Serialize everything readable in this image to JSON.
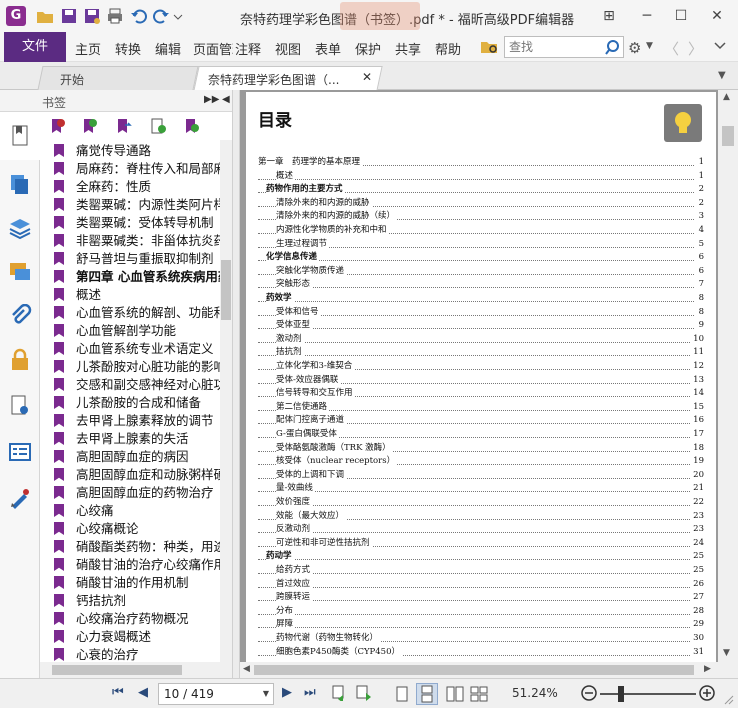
{
  "window": {
    "title": "奈特药理学彩色图谱（书签）.pdf * - 福昕高级PDF编辑器"
  },
  "menu": {
    "file": "文件",
    "items": [
      "主页",
      "转换",
      "编辑",
      "页面管理",
      "注释",
      "视图",
      "表单",
      "保护",
      "共享",
      "帮助"
    ],
    "search_placeholder": "查找"
  },
  "tabs": [
    {
      "label": "开始"
    },
    {
      "label": "奈特药理学彩色图谱（..."
    }
  ],
  "bookmarks": {
    "header": "书签",
    "items": [
      {
        "label": "痛觉传导通路",
        "bold": false
      },
      {
        "label": "局麻药：脊柱传入和局部麻醉",
        "bold": false
      },
      {
        "label": "全麻药：性质",
        "bold": false
      },
      {
        "label": "类罂粟碱：内源性类阿片样物质",
        "bold": false
      },
      {
        "label": "类罂粟碱：受体转导机制",
        "bold": false
      },
      {
        "label": "非罂粟碱类：非甾体抗炎药",
        "bold": false
      },
      {
        "label": "舒马普坦与重振取抑制剂",
        "bold": false
      },
      {
        "label": "第四章 心血管系统疾病用药",
        "bold": true
      },
      {
        "label": "概述",
        "bold": false
      },
      {
        "label": "心血管系统的解剖、功能和调节",
        "bold": false
      },
      {
        "label": "心血管解剖学功能",
        "bold": false
      },
      {
        "label": "心血管系统专业术语定义",
        "bold": false
      },
      {
        "label": "儿茶酚胺对心脏功能的影响",
        "bold": false
      },
      {
        "label": "交感和副交感神经对心脏功能",
        "bold": false
      },
      {
        "label": "儿茶酚胺的合成和储备",
        "bold": false
      },
      {
        "label": "去甲肾上腺素释放的调节",
        "bold": false
      },
      {
        "label": "去甲肾上腺素的失活",
        "bold": false
      },
      {
        "label": "高胆固醇血症的病因",
        "bold": false
      },
      {
        "label": "高胆固醇血症和动脉粥样硬化",
        "bold": false
      },
      {
        "label": "高胆固醇血症的药物治疗",
        "bold": false
      },
      {
        "label": "心绞痛",
        "bold": false
      },
      {
        "label": "心绞痛概论",
        "bold": false
      },
      {
        "label": "硝酸酯类药物：种类，用途",
        "bold": false
      },
      {
        "label": "硝酸甘油的治疗心绞痛作用",
        "bold": false
      },
      {
        "label": "硝酸甘油的作用机制",
        "bold": false
      },
      {
        "label": "钙拮抗剂",
        "bold": false
      },
      {
        "label": "心绞痛治疗药物概况",
        "bold": false
      },
      {
        "label": "心力衰竭概述",
        "bold": false
      },
      {
        "label": "心衰的治疗",
        "bold": false
      }
    ]
  },
  "document": {
    "heading": "目录",
    "toc": [
      {
        "level": 0,
        "text": "第一章　药理学的基本原理",
        "page": "1"
      },
      {
        "level": 2,
        "text": "概述",
        "page": "1"
      },
      {
        "level": 1,
        "text": "药物作用的主要方式",
        "page": "2"
      },
      {
        "level": 2,
        "text": "清除外来的和内源的威胁",
        "page": "2"
      },
      {
        "level": 2,
        "text": "清除外来的和内源的威胁（续）",
        "page": "3"
      },
      {
        "level": 2,
        "text": "内源性化学物质的补充和中和",
        "page": "4"
      },
      {
        "level": 2,
        "text": "生理过程调节",
        "page": "5"
      },
      {
        "level": 1,
        "text": "化学信息传递",
        "page": "6"
      },
      {
        "level": 2,
        "text": "突触化学物质传递",
        "page": "6"
      },
      {
        "level": 2,
        "text": "突触形态",
        "page": "7"
      },
      {
        "level": 1,
        "text": "药效学",
        "page": "8"
      },
      {
        "level": 2,
        "text": "受体和信号",
        "page": "8"
      },
      {
        "level": 2,
        "text": "受体亚型",
        "page": "9"
      },
      {
        "level": 2,
        "text": "激动剂",
        "page": "10"
      },
      {
        "level": 2,
        "text": "拮抗剂",
        "page": "11"
      },
      {
        "level": 2,
        "text": "立体化学和3-维契合",
        "page": "12"
      },
      {
        "level": 2,
        "text": "受体-效应器偶联",
        "page": "13"
      },
      {
        "level": 2,
        "text": "信号转导和交互作用",
        "page": "14"
      },
      {
        "level": 2,
        "text": "第二信使通路",
        "page": "15"
      },
      {
        "level": 2,
        "text": "配体门控离子通道",
        "page": "16"
      },
      {
        "level": 2,
        "text": "G-蛋白偶联受体",
        "page": "17"
      },
      {
        "level": 2,
        "text": "受体酪氨酸激酶（TRK 激酶）",
        "page": "18"
      },
      {
        "level": 2,
        "text": "核受体（nuclear receptors）",
        "page": "19"
      },
      {
        "level": 2,
        "text": "受体的上调和下调",
        "page": "20"
      },
      {
        "level": 2,
        "text": "量-效曲线",
        "page": "21"
      },
      {
        "level": 2,
        "text": "效价强度",
        "page": "22"
      },
      {
        "level": 2,
        "text": "效能（最大效应）",
        "page": "23"
      },
      {
        "level": 2,
        "text": "反激动剂",
        "page": "23"
      },
      {
        "level": 2,
        "text": "可逆性和非可逆性拮抗剂",
        "page": "24"
      },
      {
        "level": 1,
        "text": "药动学",
        "page": "25"
      },
      {
        "level": 2,
        "text": "给药方式",
        "page": "25"
      },
      {
        "level": 2,
        "text": "首过效应",
        "page": "26"
      },
      {
        "level": 2,
        "text": "跨膜转运",
        "page": "27"
      },
      {
        "level": 2,
        "text": "分布",
        "page": "28"
      },
      {
        "level": 2,
        "text": "屏障",
        "page": "29"
      },
      {
        "level": 2,
        "text": "药物代谢（药物生物转化）",
        "page": "30"
      },
      {
        "level": 2,
        "text": "细胞色素P450酶类（CYP450）",
        "page": "31"
      }
    ]
  },
  "status": {
    "page_indicator": "10 / 419",
    "zoom": "51.24%"
  },
  "colors": {
    "brand": "#5b2b82",
    "bookmark_flag": "#7b2a8f"
  }
}
